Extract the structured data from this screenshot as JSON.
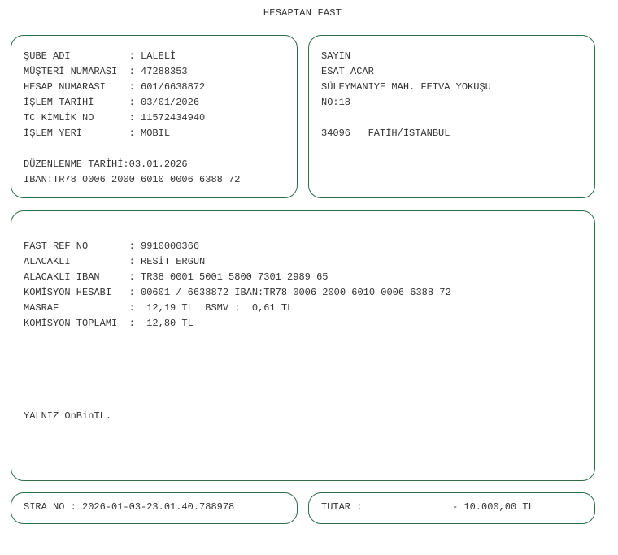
{
  "document_title": "HESAPTAN FAST",
  "branch_box": {
    "rows": [
      {
        "label": "ŞUBE ADI          ",
        "value": ": LALELİ"
      },
      {
        "label": "MÜŞTERİ NUMARASI  ",
        "value": ": 47288353"
      },
      {
        "label": "HESAP NUMARASI    ",
        "value": ": 601/6638872"
      },
      {
        "label": "İŞLEM TARİHİ      ",
        "value": ": 03/01/2026"
      },
      {
        "label": "TC KİMLİK NO      ",
        "value": ": 11572434940"
      },
      {
        "label": "İŞLEM YERİ        ",
        "value": ": MOBIL"
      }
    ],
    "issue_date": "DÜZENLENME TARİHİ:03.01.2026",
    "iban": "IBAN:TR78 0006 2000 6010 0006 6388 72"
  },
  "address_box": {
    "salutation": "SAYIN",
    "name": "ESAT ACAR",
    "street": "SÜLEYMANIYE MAH. FETVA YOKUŞU",
    "number": "NO:18",
    "city_line": "34096   FATİH/İSTANBUL"
  },
  "detail_box": {
    "rows": [
      {
        "label": "FAST REF NO       ",
        "value": ": 9910000366"
      },
      {
        "label": "ALACAKLI          ",
        "value": ": RESİT ERGUN"
      },
      {
        "label": "ALACAKLI IBAN     ",
        "value": ": TR38 0001 5001 5800 7301 2989 65"
      },
      {
        "label": "KOMİSYON HESABI   ",
        "value": ": 00601 / 6638872 IBAN:TR78 0006 2000 6010 0006 6388 72"
      },
      {
        "label": "MASRAF            ",
        "value": ":  12,19 TL  BSMV :  0,61 TL"
      },
      {
        "label": "KOMİSYON TOPLAMI  ",
        "value": ":  12,80 TL"
      }
    ],
    "amount_in_words": "YALNIZ OnBinTL."
  },
  "sira": {
    "text": "SIRA NO : 2026-01-03-23.01.40.788978"
  },
  "tutar": {
    "label": "TUTAR :",
    "amount": "- 10.000,00 TL"
  },
  "colors": {
    "border": "#2e6b4a",
    "text": "#333333"
  }
}
